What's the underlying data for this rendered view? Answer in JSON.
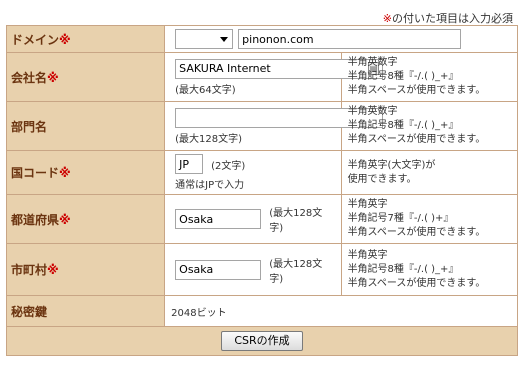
{
  "notice": {
    "mark": "※",
    "text": "の付いた項目は入力必須"
  },
  "required_mark": "※",
  "fields": {
    "domain": {
      "label": "ドメイン",
      "select_value": "",
      "value": "pinonon.com"
    },
    "company": {
      "label": "会社名",
      "value": "SAKURA Internet",
      "note": "(最大64文字)",
      "icon": "contact-card-icon",
      "hint": [
        "半角英数字",
        "半角記号8種『-/.( )_+』",
        "半角スペースが使用できます。"
      ]
    },
    "department": {
      "label": "部門名",
      "value": "",
      "note": "(最大128文字)",
      "hint": [
        "半角英数字",
        "半角記号8種『-/.( )_+』",
        "半角スペースが使用できます。"
      ]
    },
    "country": {
      "label": "国コード",
      "value": "JP",
      "note": "(2文字)",
      "note2": "通常はJPで入力",
      "hint": [
        "半角英字(大文字)が",
        "使用できます。"
      ]
    },
    "prefecture": {
      "label": "都道府県",
      "value": "Osaka",
      "note": "(最大128文字)",
      "hint": [
        "半角英字",
        "半角記号7種『-/.( )+』",
        "半角スペースが使用できます。"
      ]
    },
    "city": {
      "label": "市町村",
      "value": "Osaka",
      "note": "(最大128文字)",
      "hint": [
        "半角英字",
        "半角記号8種『-/.( )_+』",
        "半角スペースが使用できます。"
      ]
    },
    "secret_key": {
      "label": "秘密鍵",
      "value": "2048ビット"
    }
  },
  "submit_label": "CSRの作成",
  "colors": {
    "label_bg": "#e8d1ad",
    "label_text": "#6b3410",
    "required": "#cc0000",
    "border": "#c8a585"
  }
}
